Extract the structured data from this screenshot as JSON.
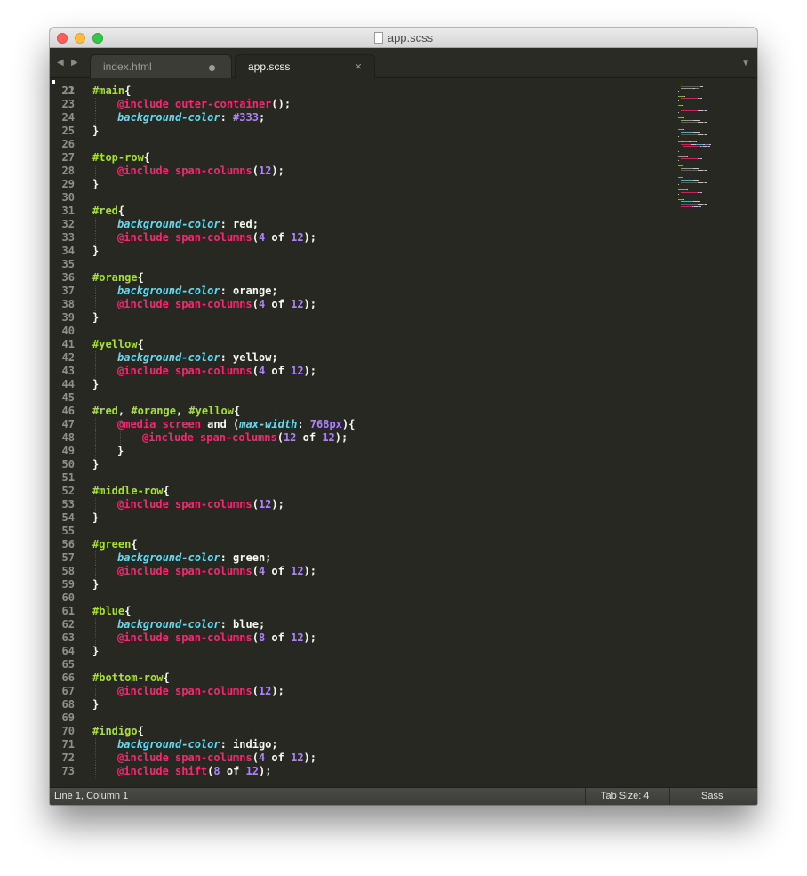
{
  "window": {
    "title": "app.scss"
  },
  "tabs": [
    {
      "label": "index.html",
      "state": "modified"
    },
    {
      "label": "app.scss",
      "state": "active"
    }
  ],
  "colors": {
    "background": "#272822",
    "selector": "#a6e22e",
    "at_rule": "#f92672",
    "property": "#66d9ef",
    "number": "#ae81ff",
    "text": "#f8f8f2",
    "line_number": "#8f908a"
  },
  "code": {
    "first_line_number": "21",
    "lines": [
      {
        "n": "22",
        "indent": 0,
        "t": [
          {
            "c": "sel",
            "s": "#main"
          },
          {
            "c": "plain",
            "s": "{"
          }
        ]
      },
      {
        "n": "23",
        "indent": 1,
        "t": [
          {
            "c": "at",
            "s": "@include outer-container"
          },
          {
            "c": "plain",
            "s": "();"
          }
        ]
      },
      {
        "n": "24",
        "indent": 1,
        "t": [
          {
            "c": "prop",
            "s": "background-color"
          },
          {
            "c": "plain",
            "s": ": "
          },
          {
            "c": "num",
            "s": "#333"
          },
          {
            "c": "plain",
            "s": ";"
          }
        ]
      },
      {
        "n": "25",
        "indent": 0,
        "t": [
          {
            "c": "plain",
            "s": "}"
          }
        ]
      },
      {
        "n": "26",
        "indent": 0,
        "t": []
      },
      {
        "n": "27",
        "indent": 0,
        "t": [
          {
            "c": "sel",
            "s": "#top-row"
          },
          {
            "c": "plain",
            "s": "{"
          }
        ]
      },
      {
        "n": "28",
        "indent": 1,
        "t": [
          {
            "c": "at",
            "s": "@include span-columns"
          },
          {
            "c": "plain",
            "s": "("
          },
          {
            "c": "num",
            "s": "12"
          },
          {
            "c": "plain",
            "s": ");"
          }
        ]
      },
      {
        "n": "29",
        "indent": 0,
        "t": [
          {
            "c": "plain",
            "s": "}"
          }
        ]
      },
      {
        "n": "30",
        "indent": 0,
        "t": []
      },
      {
        "n": "31",
        "indent": 0,
        "t": [
          {
            "c": "sel",
            "s": "#red"
          },
          {
            "c": "plain",
            "s": "{"
          }
        ]
      },
      {
        "n": "32",
        "indent": 1,
        "t": [
          {
            "c": "prop",
            "s": "background-color"
          },
          {
            "c": "plain",
            "s": ": red;"
          }
        ]
      },
      {
        "n": "33",
        "indent": 1,
        "t": [
          {
            "c": "at",
            "s": "@include span-columns"
          },
          {
            "c": "plain",
            "s": "("
          },
          {
            "c": "num",
            "s": "4"
          },
          {
            "c": "plain",
            "s": " of "
          },
          {
            "c": "num",
            "s": "12"
          },
          {
            "c": "plain",
            "s": ");"
          }
        ]
      },
      {
        "n": "34",
        "indent": 0,
        "t": [
          {
            "c": "plain",
            "s": "}"
          }
        ]
      },
      {
        "n": "35",
        "indent": 0,
        "t": []
      },
      {
        "n": "36",
        "indent": 0,
        "t": [
          {
            "c": "sel",
            "s": "#orange"
          },
          {
            "c": "plain",
            "s": "{"
          }
        ]
      },
      {
        "n": "37",
        "indent": 1,
        "t": [
          {
            "c": "prop",
            "s": "background-color"
          },
          {
            "c": "plain",
            "s": ": orange;"
          }
        ]
      },
      {
        "n": "38",
        "indent": 1,
        "t": [
          {
            "c": "at",
            "s": "@include span-columns"
          },
          {
            "c": "plain",
            "s": "("
          },
          {
            "c": "num",
            "s": "4"
          },
          {
            "c": "plain",
            "s": " of "
          },
          {
            "c": "num",
            "s": "12"
          },
          {
            "c": "plain",
            "s": ");"
          }
        ]
      },
      {
        "n": "39",
        "indent": 0,
        "t": [
          {
            "c": "plain",
            "s": "}"
          }
        ]
      },
      {
        "n": "40",
        "indent": 0,
        "t": []
      },
      {
        "n": "41",
        "indent": 0,
        "t": [
          {
            "c": "sel",
            "s": "#yellow"
          },
          {
            "c": "plain",
            "s": "{"
          }
        ]
      },
      {
        "n": "42",
        "indent": 1,
        "t": [
          {
            "c": "prop",
            "s": "background-color"
          },
          {
            "c": "plain",
            "s": ": yellow;"
          }
        ]
      },
      {
        "n": "43",
        "indent": 1,
        "t": [
          {
            "c": "at",
            "s": "@include span-columns"
          },
          {
            "c": "plain",
            "s": "("
          },
          {
            "c": "num",
            "s": "4"
          },
          {
            "c": "plain",
            "s": " of "
          },
          {
            "c": "num",
            "s": "12"
          },
          {
            "c": "plain",
            "s": ");"
          }
        ]
      },
      {
        "n": "44",
        "indent": 0,
        "t": [
          {
            "c": "plain",
            "s": "}"
          }
        ]
      },
      {
        "n": "45",
        "indent": 0,
        "t": []
      },
      {
        "n": "46",
        "indent": 0,
        "t": [
          {
            "c": "sel",
            "s": "#red"
          },
          {
            "c": "plain",
            "s": ", "
          },
          {
            "c": "sel",
            "s": "#orange"
          },
          {
            "c": "plain",
            "s": ", "
          },
          {
            "c": "sel",
            "s": "#yellow"
          },
          {
            "c": "plain",
            "s": "{"
          }
        ]
      },
      {
        "n": "47",
        "indent": 1,
        "t": [
          {
            "c": "at",
            "s": "@media screen"
          },
          {
            "c": "plain",
            "s": " and ("
          },
          {
            "c": "prop",
            "s": "max-width"
          },
          {
            "c": "plain",
            "s": ": "
          },
          {
            "c": "num",
            "s": "768px"
          },
          {
            "c": "plain",
            "s": "){"
          }
        ]
      },
      {
        "n": "48",
        "indent": 2,
        "t": [
          {
            "c": "at",
            "s": "@include span-columns"
          },
          {
            "c": "plain",
            "s": "("
          },
          {
            "c": "num",
            "s": "12"
          },
          {
            "c": "plain",
            "s": " of "
          },
          {
            "c": "num",
            "s": "12"
          },
          {
            "c": "plain",
            "s": ");"
          }
        ]
      },
      {
        "n": "49",
        "indent": 1,
        "t": [
          {
            "c": "plain",
            "s": "}"
          }
        ]
      },
      {
        "n": "50",
        "indent": 0,
        "t": [
          {
            "c": "plain",
            "s": "}"
          }
        ]
      },
      {
        "n": "51",
        "indent": 0,
        "t": []
      },
      {
        "n": "52",
        "indent": 0,
        "t": [
          {
            "c": "sel",
            "s": "#middle-row"
          },
          {
            "c": "plain",
            "s": "{"
          }
        ]
      },
      {
        "n": "53",
        "indent": 1,
        "t": [
          {
            "c": "at",
            "s": "@include span-columns"
          },
          {
            "c": "plain",
            "s": "("
          },
          {
            "c": "num",
            "s": "12"
          },
          {
            "c": "plain",
            "s": ");"
          }
        ]
      },
      {
        "n": "54",
        "indent": 0,
        "t": [
          {
            "c": "plain",
            "s": "}"
          }
        ]
      },
      {
        "n": "55",
        "indent": 0,
        "t": []
      },
      {
        "n": "56",
        "indent": 0,
        "t": [
          {
            "c": "sel",
            "s": "#green"
          },
          {
            "c": "plain",
            "s": "{"
          }
        ]
      },
      {
        "n": "57",
        "indent": 1,
        "t": [
          {
            "c": "prop",
            "s": "background-color"
          },
          {
            "c": "plain",
            "s": ": green;"
          }
        ]
      },
      {
        "n": "58",
        "indent": 1,
        "t": [
          {
            "c": "at",
            "s": "@include span-columns"
          },
          {
            "c": "plain",
            "s": "("
          },
          {
            "c": "num",
            "s": "4"
          },
          {
            "c": "plain",
            "s": " of "
          },
          {
            "c": "num",
            "s": "12"
          },
          {
            "c": "plain",
            "s": ");"
          }
        ]
      },
      {
        "n": "59",
        "indent": 0,
        "t": [
          {
            "c": "plain",
            "s": "}"
          }
        ]
      },
      {
        "n": "60",
        "indent": 0,
        "t": []
      },
      {
        "n": "61",
        "indent": 0,
        "t": [
          {
            "c": "sel",
            "s": "#blue"
          },
          {
            "c": "plain",
            "s": "{"
          }
        ]
      },
      {
        "n": "62",
        "indent": 1,
        "t": [
          {
            "c": "prop",
            "s": "background-color"
          },
          {
            "c": "plain",
            "s": ": blue;"
          }
        ]
      },
      {
        "n": "63",
        "indent": 1,
        "t": [
          {
            "c": "at",
            "s": "@include span-columns"
          },
          {
            "c": "plain",
            "s": "("
          },
          {
            "c": "num",
            "s": "8"
          },
          {
            "c": "plain",
            "s": " of "
          },
          {
            "c": "num",
            "s": "12"
          },
          {
            "c": "plain",
            "s": ");"
          }
        ]
      },
      {
        "n": "64",
        "indent": 0,
        "t": [
          {
            "c": "plain",
            "s": "}"
          }
        ]
      },
      {
        "n": "65",
        "indent": 0,
        "t": []
      },
      {
        "n": "66",
        "indent": 0,
        "t": [
          {
            "c": "sel",
            "s": "#bottom-row"
          },
          {
            "c": "plain",
            "s": "{"
          }
        ]
      },
      {
        "n": "67",
        "indent": 1,
        "t": [
          {
            "c": "at",
            "s": "@include span-columns"
          },
          {
            "c": "plain",
            "s": "("
          },
          {
            "c": "num",
            "s": "12"
          },
          {
            "c": "plain",
            "s": ");"
          }
        ]
      },
      {
        "n": "68",
        "indent": 0,
        "t": [
          {
            "c": "plain",
            "s": "}"
          }
        ]
      },
      {
        "n": "69",
        "indent": 0,
        "t": []
      },
      {
        "n": "70",
        "indent": 0,
        "t": [
          {
            "c": "sel",
            "s": "#indigo"
          },
          {
            "c": "plain",
            "s": "{"
          }
        ]
      },
      {
        "n": "71",
        "indent": 1,
        "t": [
          {
            "c": "prop",
            "s": "background-color"
          },
          {
            "c": "plain",
            "s": ": indigo;"
          }
        ]
      },
      {
        "n": "72",
        "indent": 1,
        "t": [
          {
            "c": "at",
            "s": "@include span-columns"
          },
          {
            "c": "plain",
            "s": "("
          },
          {
            "c": "num",
            "s": "4"
          },
          {
            "c": "plain",
            "s": " of "
          },
          {
            "c": "num",
            "s": "12"
          },
          {
            "c": "plain",
            "s": ");"
          }
        ]
      },
      {
        "n": "73",
        "indent": 1,
        "t": [
          {
            "c": "at",
            "s": "@include shift"
          },
          {
            "c": "plain",
            "s": "("
          },
          {
            "c": "num",
            "s": "8"
          },
          {
            "c": "plain",
            "s": " of "
          },
          {
            "c": "num",
            "s": "12"
          },
          {
            "c": "plain",
            "s": ");"
          }
        ]
      }
    ]
  },
  "statusbar": {
    "position": "Line 1, Column 1",
    "tab_size": "Tab Size: 4",
    "syntax": "Sass"
  },
  "icons": [
    "back-arrow-icon",
    "forward-arrow-icon",
    "file-icon",
    "modified-dot-icon",
    "close-icon",
    "tab-list-dropdown-icon"
  ]
}
